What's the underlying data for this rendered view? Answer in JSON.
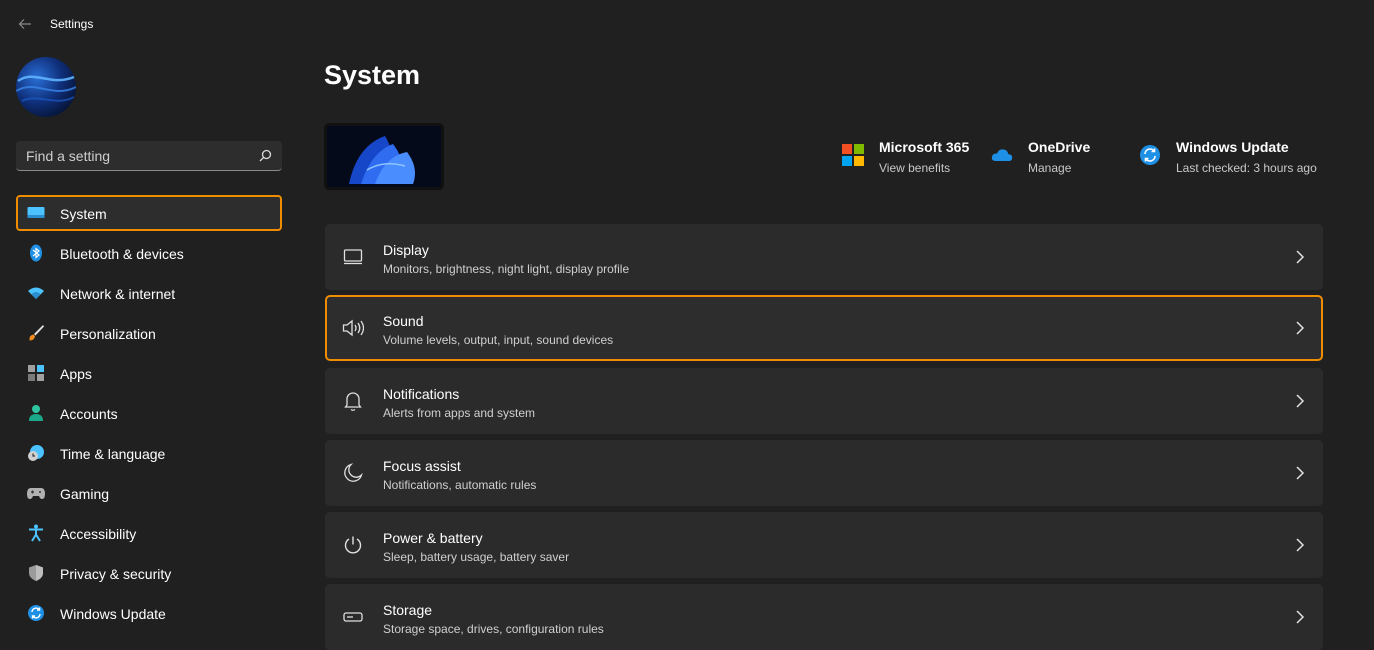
{
  "window": {
    "title": "Settings"
  },
  "search": {
    "placeholder": "Find a setting"
  },
  "sidebar": {
    "items": [
      {
        "label": "System",
        "icon": "monitor-icon",
        "active": true
      },
      {
        "label": "Bluetooth & devices",
        "icon": "bluetooth-icon"
      },
      {
        "label": "Network & internet",
        "icon": "wifi-icon"
      },
      {
        "label": "Personalization",
        "icon": "brush-icon"
      },
      {
        "label": "Apps",
        "icon": "apps-icon"
      },
      {
        "label": "Accounts",
        "icon": "person-icon"
      },
      {
        "label": "Time & language",
        "icon": "clock-globe-icon"
      },
      {
        "label": "Gaming",
        "icon": "gamepad-icon"
      },
      {
        "label": "Accessibility",
        "icon": "accessibility-icon"
      },
      {
        "label": "Privacy & security",
        "icon": "shield-icon"
      },
      {
        "label": "Windows Update",
        "icon": "update-icon"
      }
    ]
  },
  "main": {
    "title": "System",
    "quick_links": [
      {
        "title": "Microsoft 365",
        "subtitle": "View benefits",
        "icon": "microsoft-logo-icon"
      },
      {
        "title": "OneDrive",
        "subtitle": "Manage",
        "icon": "cloud-icon"
      },
      {
        "title": "Windows Update",
        "subtitle": "Last checked: 3 hours ago",
        "icon": "update-icon"
      }
    ],
    "cards": [
      {
        "title": "Display",
        "subtitle": "Monitors, brightness, night light, display profile",
        "icon": "display-icon"
      },
      {
        "title": "Sound",
        "subtitle": "Volume levels, output, input, sound devices",
        "icon": "speaker-icon",
        "highlighted": true
      },
      {
        "title": "Notifications",
        "subtitle": "Alerts from apps and system",
        "icon": "bell-icon"
      },
      {
        "title": "Focus assist",
        "subtitle": "Notifications, automatic rules",
        "icon": "moon-icon"
      },
      {
        "title": "Power & battery",
        "subtitle": "Sleep, battery usage, battery saver",
        "icon": "power-icon"
      },
      {
        "title": "Storage",
        "subtitle": "Storage space, drives, configuration rules",
        "icon": "storage-icon"
      }
    ]
  },
  "colors": {
    "background": "#202020",
    "card": "#2b2b2b",
    "highlight": "#f08c00",
    "accent": "#4cc2ff"
  }
}
